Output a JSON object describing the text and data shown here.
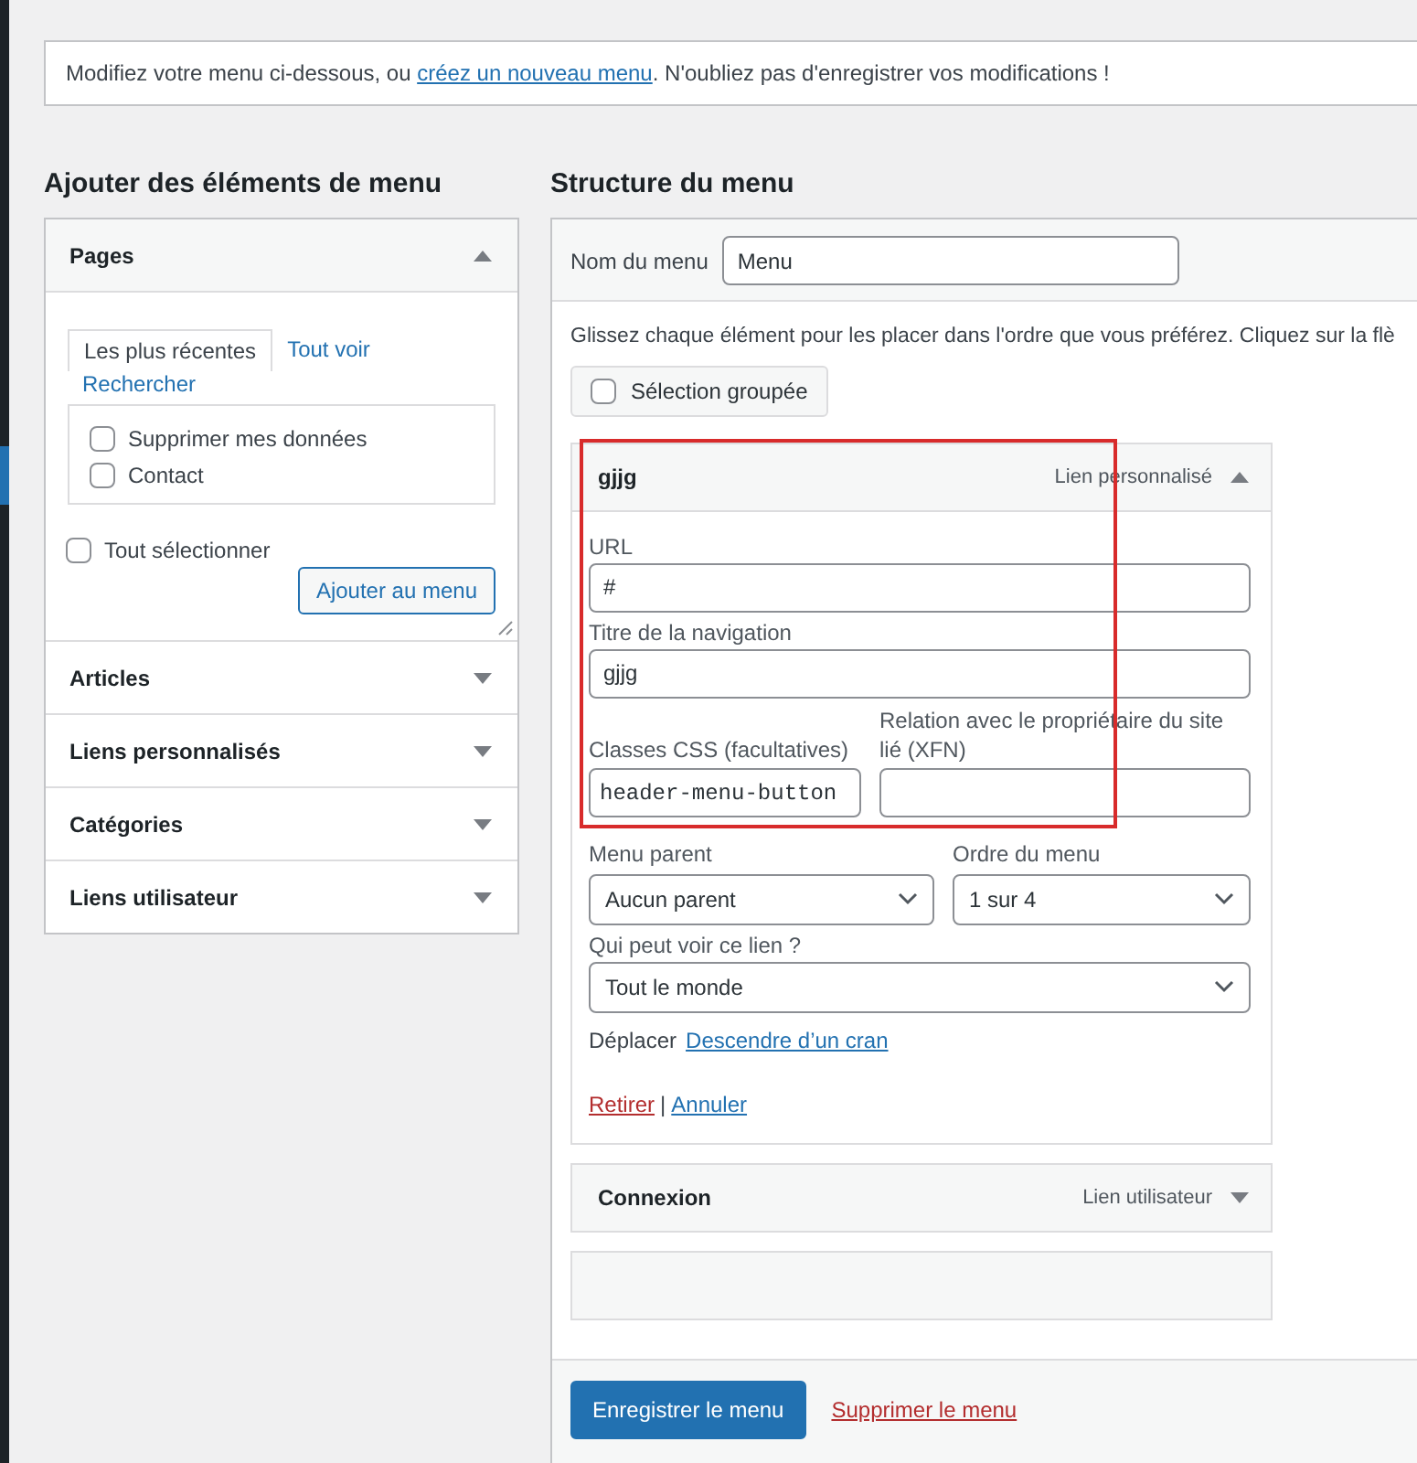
{
  "notice": {
    "text_before": "Modifiez votre menu ci-dessous, ou ",
    "link": "créez un nouveau menu",
    "text_after": ". N'oubliez pas d'enregistrer vos modifications !"
  },
  "add_items": {
    "title": "Ajouter des éléments de menu",
    "sections": [
      {
        "title": "Pages",
        "expanded": true,
        "tabs": [
          {
            "label": "Les plus récentes",
            "selected": true
          },
          {
            "label": "Tout voir",
            "selected": false
          },
          {
            "label": "Rechercher",
            "selected": false
          }
        ],
        "items": [
          {
            "label": "Supprimer mes données",
            "checked": false
          },
          {
            "label": "Contact",
            "checked": false
          }
        ],
        "select_all": {
          "label": "Tout sélectionner",
          "checked": false
        },
        "add_button": "Ajouter au menu"
      },
      {
        "title": "Articles",
        "expanded": false
      },
      {
        "title": "Liens personnalisés",
        "expanded": false
      },
      {
        "title": "Catégories",
        "expanded": false
      },
      {
        "title": "Liens utilisateur",
        "expanded": false
      }
    ]
  },
  "structure": {
    "title": "Structure du menu",
    "menu_name": {
      "label": "Nom du menu",
      "value": "Menu"
    },
    "instructions": "Glissez chaque élément pour les placer dans l'ordre que vous préférez. Cliquez sur la flè",
    "bulk_select": {
      "label": "Sélection groupée",
      "checked": false
    },
    "items": [
      {
        "title": "gjjg",
        "type_label": "Lien personnalisé",
        "expanded": true,
        "highlighted": true,
        "url": {
          "label": "URL",
          "value": "#"
        },
        "nav_title": {
          "label": "Titre de la navigation",
          "value": "gjjg"
        },
        "css_classes": {
          "label": "Classes CSS (facultatives)",
          "value": "header-menu-button"
        },
        "xfn": {
          "label": "Relation avec le propriétaire du site lié (XFN)"
        },
        "parent": {
          "label": "Menu parent",
          "value": "Aucun parent"
        },
        "order": {
          "label": "Ordre du menu",
          "value": "1 sur 4"
        },
        "visibility": {
          "label": "Qui peut voir ce lien ?",
          "value": "Tout le monde"
        },
        "move": {
          "label": "Déplacer",
          "link": "Descendre d’un cran"
        },
        "actions": {
          "remove": "Retirer",
          "separator": "|",
          "cancel": "Annuler"
        }
      },
      {
        "title": "Connexion",
        "type_label": "Lien utilisateur",
        "expanded": false,
        "highlighted": false
      }
    ],
    "save_button": "Enregistrer le menu",
    "delete_link": "Supprimer le menu"
  }
}
